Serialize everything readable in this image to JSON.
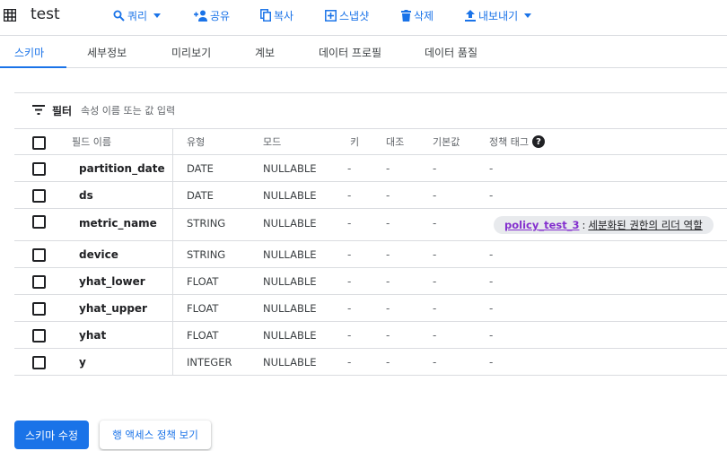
{
  "header": {
    "title": "test",
    "actions": {
      "query": "쿼리",
      "share": "공유",
      "copy": "복사",
      "snapshot": "스냅샷",
      "delete": "삭제",
      "export": "내보내기"
    }
  },
  "tabs": [
    "스키마",
    "세부정보",
    "미리보기",
    "계보",
    "데이터 프로필",
    "데이터 품질"
  ],
  "active_tab": "스키마",
  "filter": {
    "label": "필터",
    "placeholder": "속성 이름 또는 값 입력"
  },
  "table": {
    "headers": {
      "name": "필드 이름",
      "type": "유형",
      "mode": "모드",
      "key": "키",
      "collation": "대조",
      "default": "기본값",
      "policy": "정책 태그"
    },
    "rows": [
      {
        "name": "partition_date",
        "type": "DATE",
        "mode": "NULLABLE",
        "key": "-",
        "collation": "-",
        "default": "-",
        "policy": "-"
      },
      {
        "name": "ds",
        "type": "DATE",
        "mode": "NULLABLE",
        "key": "-",
        "collation": "-",
        "default": "-",
        "policy": "-"
      },
      {
        "name": "metric_name",
        "type": "STRING",
        "mode": "NULLABLE",
        "key": "-",
        "collation": "-",
        "default": "-",
        "policy_tag": "policy_test_3",
        "policy_sep": ":",
        "policy_desc": "세분화된 권한의 리더 역할"
      },
      {
        "name": "device",
        "type": "STRING",
        "mode": "NULLABLE",
        "key": "-",
        "collation": "-",
        "default": "-",
        "policy": "-"
      },
      {
        "name": "yhat_lower",
        "type": "FLOAT",
        "mode": "NULLABLE",
        "key": "-",
        "collation": "-",
        "default": "-",
        "policy": "-"
      },
      {
        "name": "yhat_upper",
        "type": "FLOAT",
        "mode": "NULLABLE",
        "key": "-",
        "collation": "-",
        "default": "-",
        "policy": "-"
      },
      {
        "name": "yhat",
        "type": "FLOAT",
        "mode": "NULLABLE",
        "key": "-",
        "collation": "-",
        "default": "-",
        "policy": "-"
      },
      {
        "name": "y",
        "type": "INTEGER",
        "mode": "NULLABLE",
        "key": "-",
        "collation": "-",
        "default": "-",
        "policy": "-"
      }
    ]
  },
  "buttons": {
    "edit_schema": "스키마 수정",
    "row_access": "행 액세스 정책 보기"
  },
  "colors": {
    "accent": "#1a73e8",
    "policy_tag": "#8430ce",
    "chip_bg": "#e8eaed",
    "divider": "#dadce0"
  },
  "icons": [
    "table-icon",
    "search-icon",
    "person-add-icon",
    "copy-icon",
    "snapshot-icon",
    "trash-icon",
    "upload-icon",
    "filter-icon",
    "help-icon"
  ]
}
